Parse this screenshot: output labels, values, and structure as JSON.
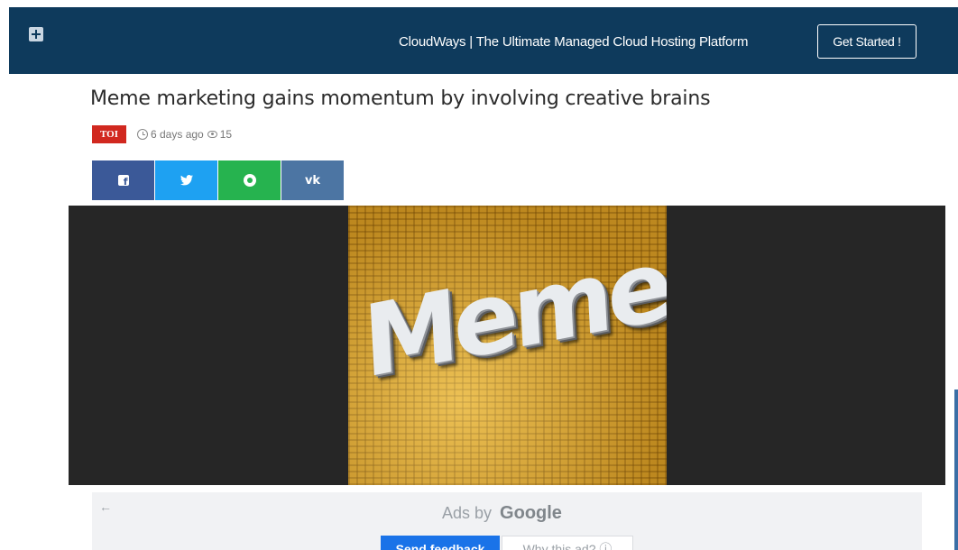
{
  "header": {
    "promo_text": "CloudWays | The Ultimate Managed Cloud Hosting Platform",
    "cta_label": "Get Started !",
    "background_color": "#0e3a5c"
  },
  "article": {
    "title": "Meme marketing gains momentum by involving creative brains",
    "source_badge": "TOI",
    "time_ago": "6 days ago",
    "views": "15"
  },
  "share": {
    "buttons": [
      {
        "network": "facebook",
        "icon": "facebook-icon",
        "color": "#3b5998"
      },
      {
        "network": "twitter",
        "icon": "twitter-icon",
        "color": "#1ea1f2"
      },
      {
        "network": "whatsapp",
        "icon": "whatsapp-icon",
        "color": "#26b34f"
      },
      {
        "network": "vk",
        "icon": "vk-icon",
        "label": "vk",
        "color": "#4c75a3"
      }
    ]
  },
  "hero_image": {
    "word": "Meme"
  },
  "ad": {
    "ads_by": "Ads by",
    "brand": "Google",
    "send_feedback": "Send feedback",
    "why_this_ad": "Why this ad? ⓘ"
  }
}
